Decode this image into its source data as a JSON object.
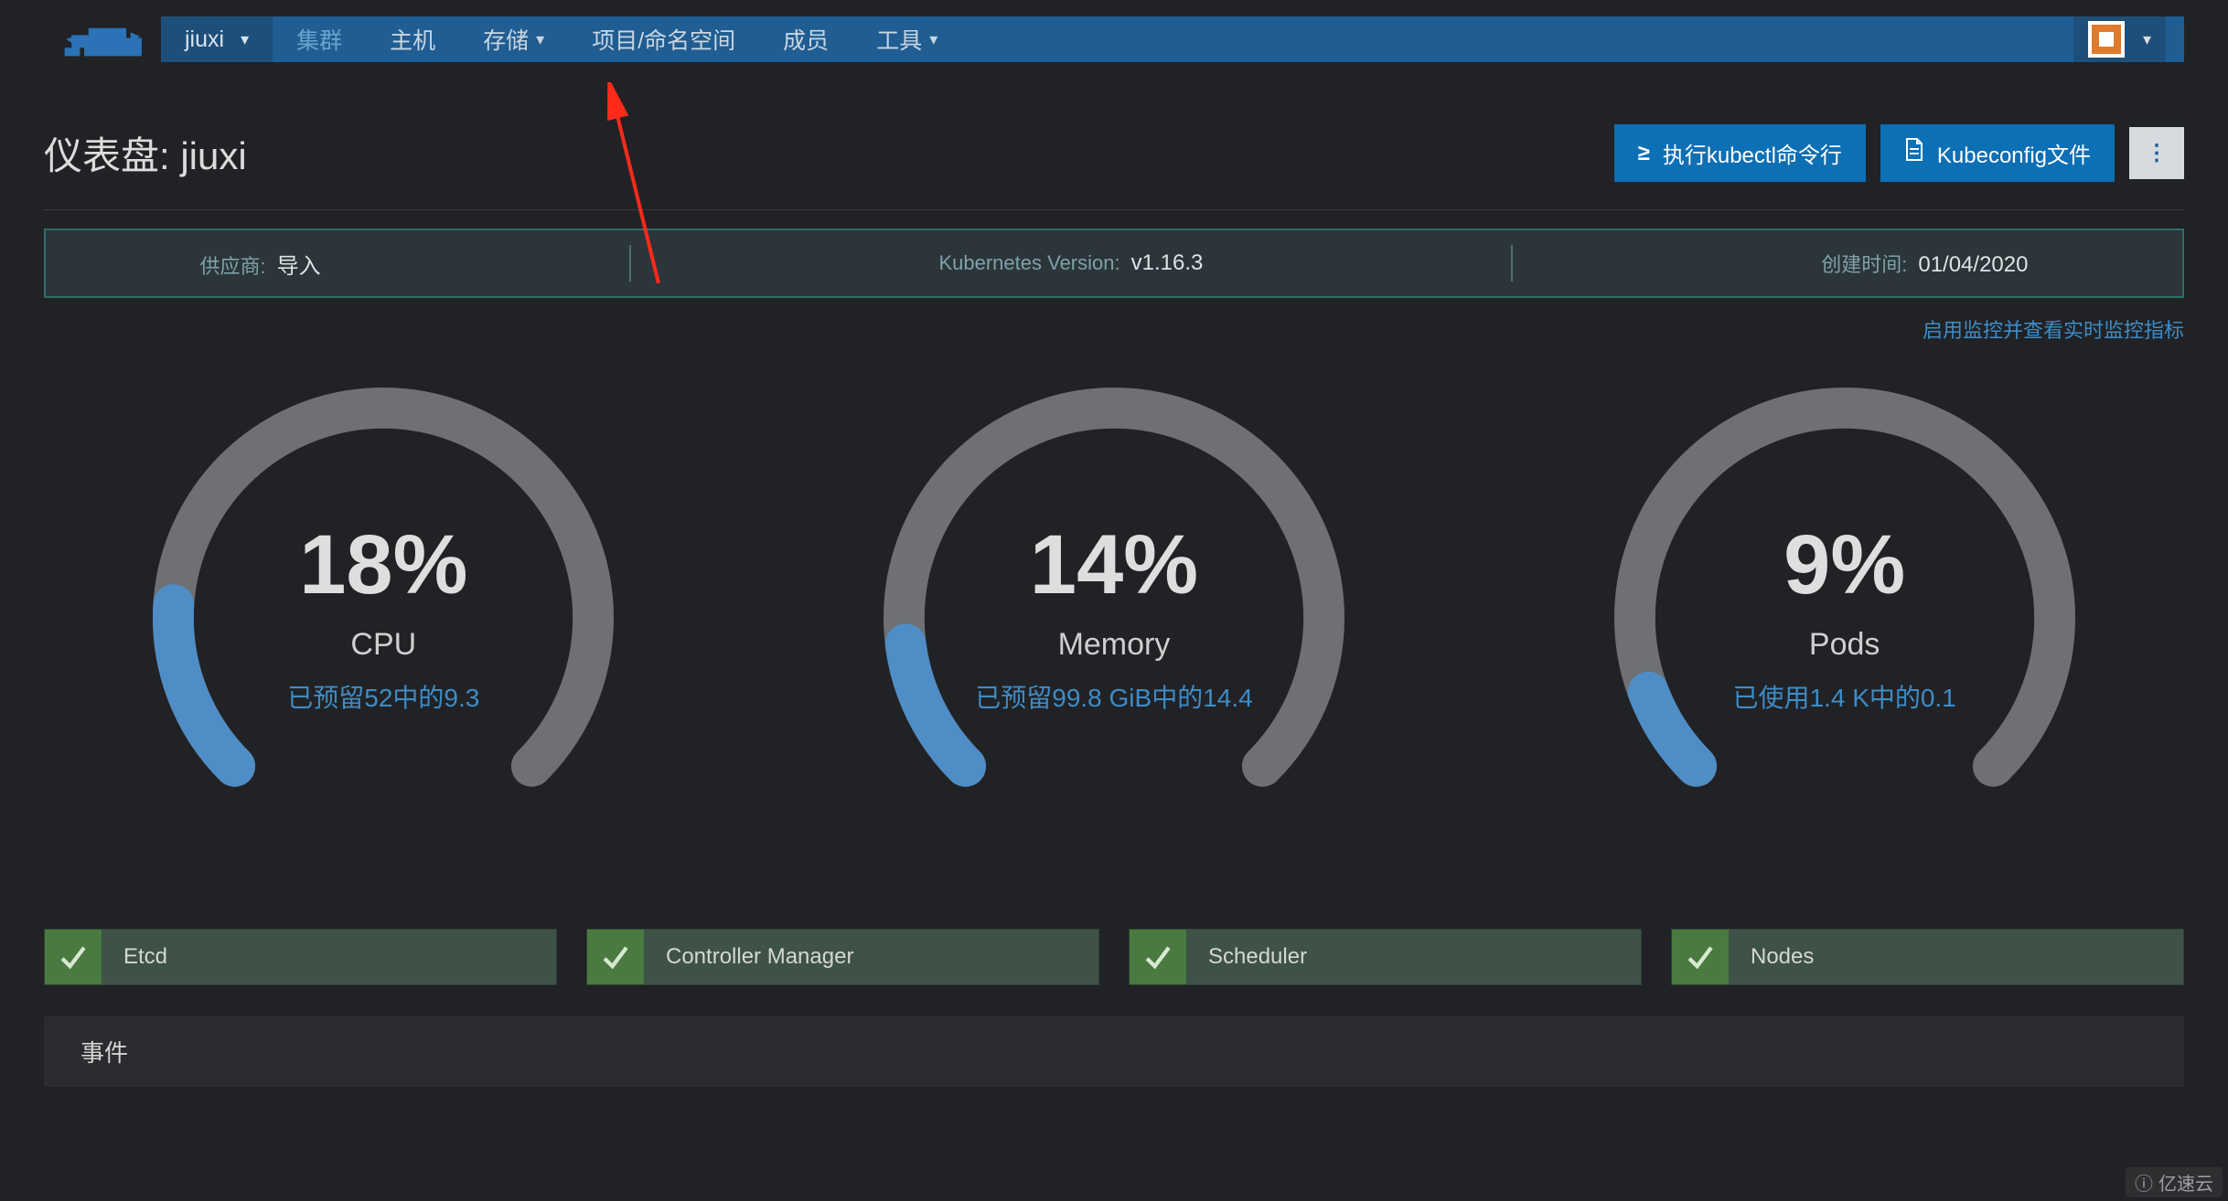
{
  "nav": {
    "cluster": "jiuxi",
    "items": [
      "集群",
      "主机",
      "存储",
      "项目/命名空间",
      "成员",
      "工具"
    ],
    "has_dropdown": [
      false,
      false,
      true,
      false,
      false,
      true
    ],
    "active_index": 0
  },
  "page": {
    "title_prefix": "仪表盘:",
    "title_name": "jiuxi"
  },
  "actions": {
    "kubectl": "执行kubectl命令行",
    "kubeconfig": "Kubeconfig文件"
  },
  "info": {
    "provider_label": "供应商:",
    "provider_value": "导入",
    "k8s_label": "Kubernetes Version:",
    "k8s_value": "v1.16.3",
    "created_label": "创建时间:",
    "created_value": "01/04/2020"
  },
  "monitor_link": "启用监控并查看实时监控指标",
  "gauges": [
    {
      "name": "CPU",
      "percent": 18,
      "percent_text": "18%",
      "detail": "已预留52中的9.3"
    },
    {
      "name": "Memory",
      "percent": 14,
      "percent_text": "14%",
      "detail": "已预留99.8 GiB中的14.4"
    },
    {
      "name": "Pods",
      "percent": 9,
      "percent_text": "9%",
      "detail": "已使用1.4 K中的0.1"
    }
  ],
  "health": [
    "Etcd",
    "Controller Manager",
    "Scheduler",
    "Nodes"
  ],
  "events_label": "事件",
  "watermark": "亿速云",
  "colors": {
    "accent": "#0d6fb4",
    "gauge_track": "#6e7073",
    "gauge_fill": "#4f8dc6",
    "link": "#3e8cc7",
    "health_ok": "#4a7a3f"
  },
  "chart_data": [
    {
      "type": "gauge",
      "title": "CPU",
      "value": 18,
      "max": 100,
      "unit": "%",
      "reserved": 9.3,
      "capacity": 52,
      "capacity_unit": ""
    },
    {
      "type": "gauge",
      "title": "Memory",
      "value": 14,
      "max": 100,
      "unit": "%",
      "reserved": 14.4,
      "capacity": 99.8,
      "capacity_unit": "GiB"
    },
    {
      "type": "gauge",
      "title": "Pods",
      "value": 9,
      "max": 100,
      "unit": "%",
      "used": 0.1,
      "capacity": 1.4,
      "capacity_unit": "K"
    }
  ]
}
